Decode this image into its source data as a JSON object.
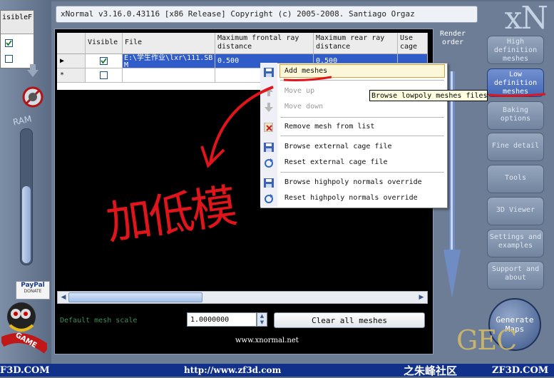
{
  "window": {
    "title": "xNormal v3.16.0.43116 [x86 Release] Copyright (c) 2005-2008. Santiago Orgaz",
    "logo": "xN"
  },
  "left_partial": {
    "col_visible": "isible",
    "col_f": "F",
    "ram_label": "RAM",
    "paypal_label": "PayPal",
    "donate_label": "DONATE",
    "game_label": "GAME"
  },
  "grid": {
    "columns": [
      "Visible",
      "File",
      "Maximum frontal ray distance",
      "Maximum rear ray distance",
      "Use cage"
    ],
    "rows": [
      {
        "marker": "▶",
        "visible": true,
        "file": "E:\\学生作业\\lxr\\111.SBM",
        "frontal": "0.500",
        "rear": "0.500"
      },
      {
        "marker": "*",
        "visible": false,
        "file": "",
        "frontal": "",
        "rear": ""
      }
    ]
  },
  "render_order": "Render order",
  "bottom": {
    "scale_label": "Default mesh scale",
    "scale_value": "1.0000000",
    "clear_button": "Clear all meshes",
    "website": "www.xnormal.net"
  },
  "context_menu": {
    "items": [
      {
        "label": "Add meshes",
        "enabled": true,
        "icon": "save-icon",
        "highlighted": true
      },
      {
        "label": "Move up",
        "enabled": false,
        "icon": "up-arrow-icon"
      },
      {
        "label": "Move down",
        "enabled": false,
        "icon": "down-arrow-icon"
      },
      {
        "label": "Remove mesh from list",
        "enabled": true,
        "icon": "remove-icon"
      },
      {
        "label": "Browse external cage file",
        "enabled": true,
        "icon": "save-icon"
      },
      {
        "label": "Reset external cage file",
        "enabled": true,
        "icon": "reset-icon"
      },
      {
        "label": "Browse highpoly normals override",
        "enabled": true,
        "icon": "save-icon"
      },
      {
        "label": "Reset highpoly normals override",
        "enabled": true,
        "icon": "reset-icon"
      }
    ]
  },
  "tooltip": "Browse lowpoly meshes files",
  "side_buttons": [
    "High definition meshes",
    "Low definition meshes",
    "Baking options",
    "Fine detail",
    "Tools",
    "3D Viewer",
    "Settings and examples",
    "Support and about"
  ],
  "generate_button": "Generate Maps",
  "annotation_text": "加低模",
  "watermark": {
    "left": "F3D.COM",
    "url": "http://www.zf3d.com",
    "cn": "之朱峰社区",
    "right": "ZF3D.COM",
    "gec": "GEC"
  },
  "colors": {
    "background": "#5f6f86",
    "panel": "#000000",
    "accent_red": "#e0141b",
    "button": "#8394ad",
    "banner": "#10308a"
  }
}
